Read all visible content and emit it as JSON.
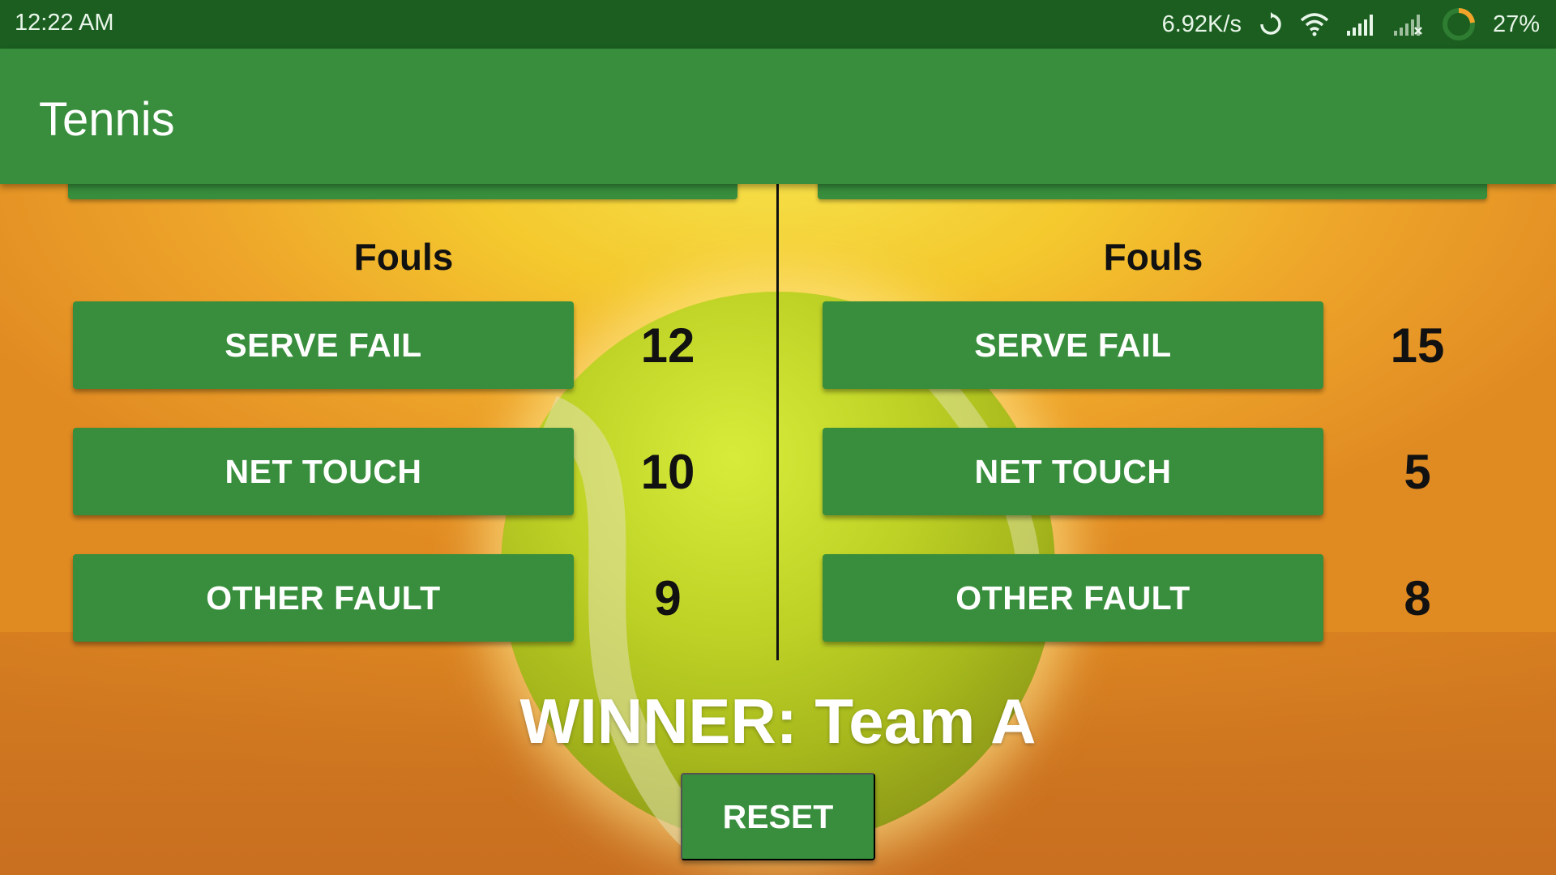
{
  "status_bar": {
    "time": "12:22 AM",
    "network_speed": "6.92K/s",
    "battery": "27%",
    "icons": [
      "sync-icon",
      "wifi-icon",
      "signal-icon",
      "signal-no-sim-icon",
      "battery-ring-icon"
    ]
  },
  "app_bar": {
    "title": "Tennis"
  },
  "team_a": {
    "heading": "Fouls",
    "fouls": [
      {
        "label": "SERVE FAIL",
        "count": "12"
      },
      {
        "label": "NET TOUCH",
        "count": "10"
      },
      {
        "label": "OTHER FAULT",
        "count": "9"
      }
    ]
  },
  "team_b": {
    "heading": "Fouls",
    "fouls": [
      {
        "label": "SERVE FAIL",
        "count": "15"
      },
      {
        "label": "NET TOUCH",
        "count": "5"
      },
      {
        "label": "OTHER FAULT",
        "count": "8"
      }
    ]
  },
  "winner": "WINNER: Team A",
  "reset_label": "RESET",
  "colors": {
    "primary": "#388e3c",
    "primary_dark": "#1b5e20",
    "button_text": "#ffffff"
  }
}
